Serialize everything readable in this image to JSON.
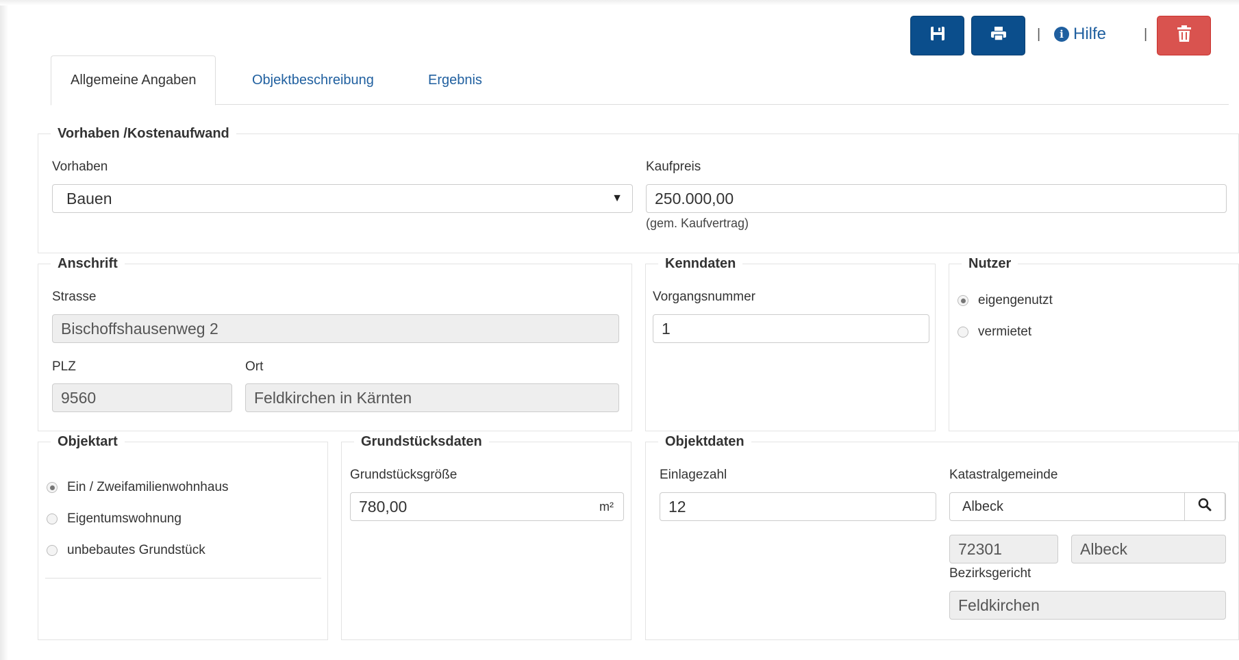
{
  "toolbar": {
    "save_icon": "floppy-disk-icon",
    "print_icon": "print-icon",
    "separator": "|",
    "help_label": "Hilfe",
    "delete_icon": "trash-icon",
    "colors": {
      "primary": "#0b4e8c",
      "danger": "#d9534f",
      "link": "#1f5f9f"
    }
  },
  "tabs": [
    {
      "label": "Allgemeine Angaben",
      "active": true
    },
    {
      "label": "Objektbeschreibung",
      "active": false
    },
    {
      "label": "Ergebnis",
      "active": false
    }
  ],
  "vorhaben": {
    "legend": "Vorhaben /Kostenaufwand",
    "vorhaben_label": "Vorhaben",
    "vorhaben_value": "Bauen",
    "kaufpreis_label": "Kaufpreis",
    "kaufpreis_value": "250.000,00",
    "kaufpreis_help": "(gem. Kaufvertrag)"
  },
  "anschrift": {
    "legend": "Anschrift",
    "strasse_label": "Strasse",
    "strasse_value": "Bischoffshausenweg 2",
    "plz_label": "PLZ",
    "plz_value": "9560",
    "ort_label": "Ort",
    "ort_value": "Feldkirchen in Kärnten"
  },
  "kenndaten": {
    "legend": "Kenndaten",
    "vorgangsnummer_label": "Vorgangsnummer",
    "vorgangsnummer_value": "1"
  },
  "nutzer": {
    "legend": "Nutzer",
    "options": [
      {
        "label": "eigengenutzt",
        "checked": true
      },
      {
        "label": "vermietet",
        "checked": false
      }
    ]
  },
  "objektart": {
    "legend": "Objektart",
    "options": [
      {
        "label": "Ein / Zweifamilienwohnhaus",
        "checked": true
      },
      {
        "label": "Eigentumswohnung",
        "checked": false
      },
      {
        "label": "unbebautes Grundstück",
        "checked": false
      }
    ]
  },
  "grundstuck": {
    "legend": "Grundstücksdaten",
    "groesse_label": "Grundstücksgröße",
    "groesse_value": "780,00",
    "groesse_unit": "m²"
  },
  "objektdaten": {
    "legend": "Objektdaten",
    "einlagezahl_label": "Einlagezahl",
    "einlagezahl_value": "12",
    "kg_label": "Katastralgemeinde",
    "kg_value": "Albeck",
    "kg_search_icon": "search-icon",
    "kg_number": "72301",
    "kg_name": "Albeck",
    "bezirksgericht_label": "Bezirksgericht",
    "bezirksgericht_value": "Feldkirchen"
  }
}
